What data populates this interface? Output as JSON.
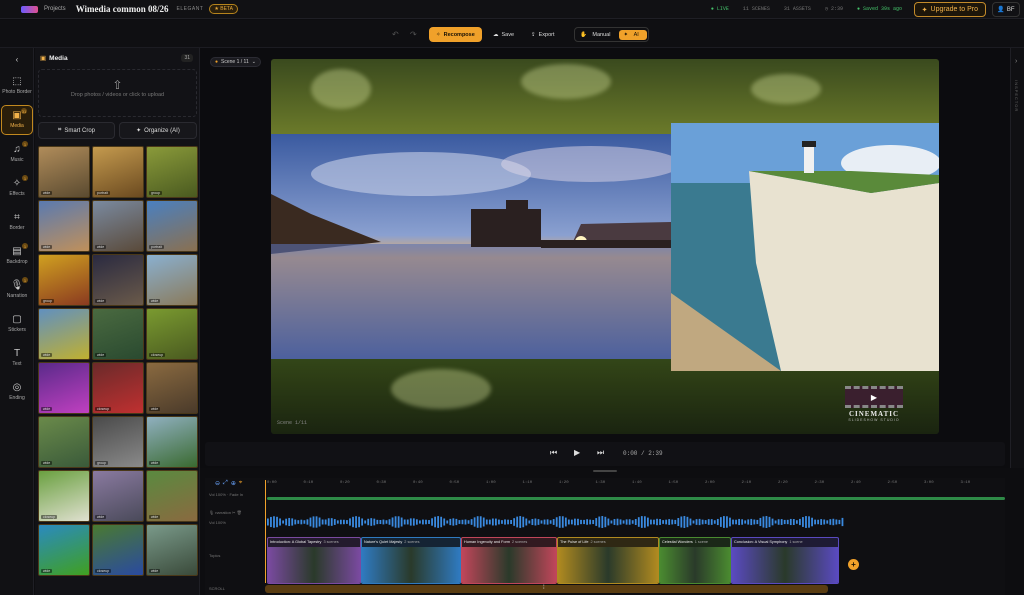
{
  "topbar": {
    "crumb": "Projects",
    "title": "Wimedia common 08/26",
    "style": "ELEGANT",
    "beta": "BETA",
    "status": [
      "LIVE",
      "11 SCENES",
      "31 ASSETS",
      "2:39",
      "Saved 39s ago"
    ],
    "upgrade": "Upgrade to Pro",
    "user_initials": "BF"
  },
  "toolbar": {
    "recompose": "Recompose",
    "save": "Save",
    "export": "Export",
    "mode_manual": "Manual",
    "mode_ai": "AI"
  },
  "rail": [
    {
      "label": "Photo Border",
      "icon": "photo-border-icon"
    },
    {
      "label": "Media",
      "icon": "media-icon",
      "badge": "31"
    },
    {
      "label": "Music",
      "icon": "music-icon",
      "badge": "1"
    },
    {
      "label": "Effects",
      "icon": "effects-icon",
      "badge": "1"
    },
    {
      "label": "Border",
      "icon": "border-icon"
    },
    {
      "label": "Backdrop",
      "icon": "backdrop-icon",
      "badge": "1"
    },
    {
      "label": "Narration",
      "icon": "narration-icon",
      "badge": "1"
    },
    {
      "label": "Stickers",
      "icon": "stickers-icon"
    },
    {
      "label": "Text",
      "icon": "text-icon"
    },
    {
      "label": "Ending",
      "icon": "ending-icon"
    }
  ],
  "panel": {
    "title": "Media",
    "count": "31",
    "drop_text": "Drop photos / videos or click to upload",
    "smart_crop": "Smart Crop",
    "organize": "Organize (AI)"
  },
  "thumbs": [
    {
      "tag": "wide",
      "c1": "#b08c5a",
      "c2": "#5a4a30"
    },
    {
      "tag": "portrait",
      "c1": "#c49a4e",
      "c2": "#6b4a20"
    },
    {
      "tag": "group",
      "c1": "#8a9a3a",
      "c2": "#4a5a20"
    },
    {
      "tag": "wide",
      "c1": "#5a7ab0",
      "c2": "#c0905a"
    },
    {
      "tag": "wide",
      "c1": "#7a8aa0",
      "c2": "#5a4a3a"
    },
    {
      "tag": "portrait",
      "c1": "#4a80c0",
      "c2": "#8a7050"
    },
    {
      "tag": "group",
      "c1": "#d0a020",
      "c2": "#8a3a20"
    },
    {
      "tag": "wide",
      "c1": "#2a2a40",
      "c2": "#6a5a4a"
    },
    {
      "tag": "wide",
      "c1": "#8ab0d0",
      "c2": "#8a7a5a"
    },
    {
      "tag": "wide",
      "c1": "#6090c0",
      "c2": "#c0b030"
    },
    {
      "tag": "wide",
      "c1": "#4a6a40",
      "c2": "#2a4a30"
    },
    {
      "tag": "closeup",
      "c1": "#7a9a30",
      "c2": "#4a5a20"
    },
    {
      "tag": "wide",
      "c1": "#5a2a8a",
      "c2": "#c040c0"
    },
    {
      "tag": "closeup",
      "c1": "#6a2a2a",
      "c2": "#c03030"
    },
    {
      "tag": "wide",
      "c1": "#8a6a40",
      "c2": "#4a3a2a"
    },
    {
      "tag": "wide",
      "c1": "#6a8a4a",
      "c2": "#3a5a3a"
    },
    {
      "tag": "group",
      "c1": "#4a4a4a",
      "c2": "#8a8a8a"
    },
    {
      "tag": "wide",
      "c1": "#90b0c0",
      "c2": "#3a6a30"
    },
    {
      "tag": "closeup",
      "c1": "#6aa040",
      "c2": "#e0e0d0"
    },
    {
      "tag": "wide",
      "c1": "#8a7aa0",
      "c2": "#4a4a5a"
    },
    {
      "tag": "wide",
      "c1": "#5a8a40",
      "c2": "#8a6a40"
    },
    {
      "tag": "wide",
      "c1": "#2a8ac0",
      "c2": "#40a020"
    },
    {
      "tag": "closeup",
      "c1": "#4a7a30",
      "c2": "#2a4aa0"
    },
    {
      "tag": "wide",
      "c1": "#7a9a8a",
      "c2": "#3a4a3a"
    }
  ],
  "stage": {
    "scene_tag": "Scene 1 / 11",
    "scene_label": "Scene 1/11",
    "watermark_title": "CINEMATIC",
    "watermark_sub": "SLIDESHOW STUDIO",
    "inspector": "INSPECTOR"
  },
  "player": {
    "time": "0:00 / 2:39"
  },
  "timeline": {
    "ruler": [
      "0:00",
      "0:10",
      "0:20",
      "0:30",
      "0:40",
      "0:50",
      "1:00",
      "1:10",
      "1:20",
      "1:30",
      "1:40",
      "1:50",
      "2:00",
      "2:10",
      "2:20",
      "2:30",
      "2:40",
      "2:50",
      "3:00",
      "3:10"
    ],
    "music_label": "Vol 100%",
    "music_sub": "Fade In",
    "narration_label": "narration",
    "narration_vol": "Vol 100%",
    "topics_label": "Topics",
    "scroll_label": "SCROLL",
    "scenes": [
      {
        "name": "Introduction: A Global Tapestry",
        "count": "3 scenes",
        "color": "#7a4aa0",
        "w": 94
      },
      {
        "name": "Nature's Quiet Majesty",
        "count": "2 scenes",
        "color": "#2f7ac0",
        "w": 100
      },
      {
        "name": "Human Ingenuity and Form",
        "count": "2 scenes",
        "color": "#c0465a",
        "w": 96
      },
      {
        "name": "The Pulse of Life",
        "count": "2 scenes",
        "color": "#b08a20",
        "w": 102
      },
      {
        "name": "Celestial Wonders",
        "count": "1 scene",
        "color": "#4a8a30",
        "w": 72
      },
      {
        "name": "Conclusion: A Visual Symphony",
        "count": "1 scene",
        "color": "#5a4ac0",
        "w": 108
      }
    ]
  }
}
